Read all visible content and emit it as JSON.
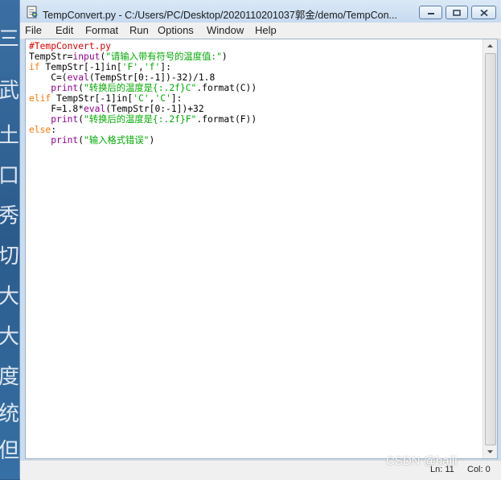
{
  "window": {
    "title": "TempConvert.py - C:/Users/PC/Desktop/2020110201037郭金/demo/TempCon..."
  },
  "menu": {
    "items": [
      "File",
      "Edit",
      "Format",
      "Run",
      "Options",
      "Window",
      "Help"
    ]
  },
  "editor": {
    "lines": [
      "#TempConvert.py",
      "TempStr=input(\"请输入带有符号的温度值:\")",
      "if TempStr[-1]in['F','f']:",
      "    C=(eval(TempStr[0:-1])-32)/1.8",
      "    print(\"转换后的温度是{:.2f}C\".format(C))",
      "elif TempStr[-1]in['C','C']:",
      "    F=1.8*eval(TempStr[0:-1])+32",
      "    print(\"转换后的温度是{:.2f}F\".format(F))",
      "else:",
      "    print(\"输入格式错误\")"
    ]
  },
  "status": {
    "line": "Ln: 11",
    "col": "Col: 0"
  },
  "watermark": "CSDN @baili",
  "wallpaper": {
    "glyphs": [
      "三",
      "武",
      "土",
      "口",
      "秀",
      "切",
      "大",
      "大",
      "度",
      "统",
      "但"
    ]
  },
  "colors": {
    "keyword": "#ff7700",
    "builtin": "#900090",
    "string": "#00aa00",
    "comment": "#dd0000"
  }
}
